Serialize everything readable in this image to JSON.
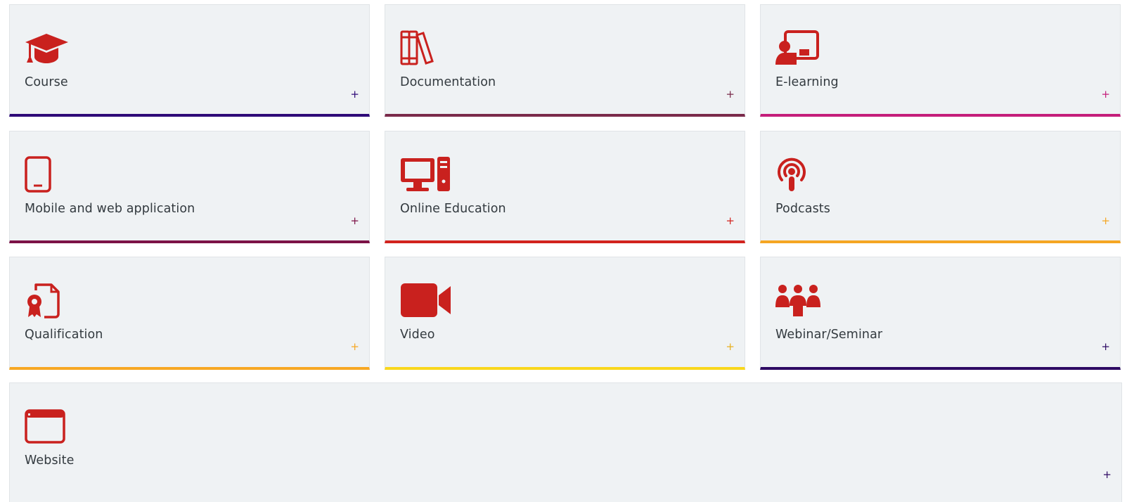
{
  "colors": {
    "icon": "#c9211e",
    "card_bg": "#eff2f4",
    "text": "#333a3f"
  },
  "cards": [
    {
      "label": "Course",
      "icon": "graduation-cap-icon",
      "accent": "#2e0a78",
      "plus_color": "#2e0a78"
    },
    {
      "label": "Documentation",
      "icon": "books-icon",
      "accent": "#7a2a4a",
      "plus_color": "#7a2a4a"
    },
    {
      "label": "E-learning",
      "icon": "teacher-board-icon",
      "accent": "#c41e7a",
      "plus_color": "#c41e7a"
    },
    {
      "label": "Mobile and web application",
      "icon": "tablet-icon",
      "accent": "#7c1247",
      "plus_color": "#7c1247"
    },
    {
      "label": "Online Education",
      "icon": "desktop-computer-icon",
      "accent": "#d2231e",
      "plus_color": "#d2231e"
    },
    {
      "label": "Podcasts",
      "icon": "podcast-icon",
      "accent": "#f5a623",
      "plus_color": "#f5a623"
    },
    {
      "label": "Qualification",
      "icon": "certificate-icon",
      "accent": "#f7a823",
      "plus_color": "#f7a823"
    },
    {
      "label": "Video",
      "icon": "video-camera-icon",
      "accent": "#f9d71c",
      "plus_color": "#e8b020"
    },
    {
      "label": "Webinar/Seminar",
      "icon": "group-of-people-icon",
      "accent": "#2e0a63",
      "plus_color": "#2e0a63"
    },
    {
      "label": "Website",
      "icon": "browser-window-icon",
      "accent": "#eff2f4",
      "plus_color": "#2e0a63"
    }
  ],
  "plus_symbol": "+"
}
